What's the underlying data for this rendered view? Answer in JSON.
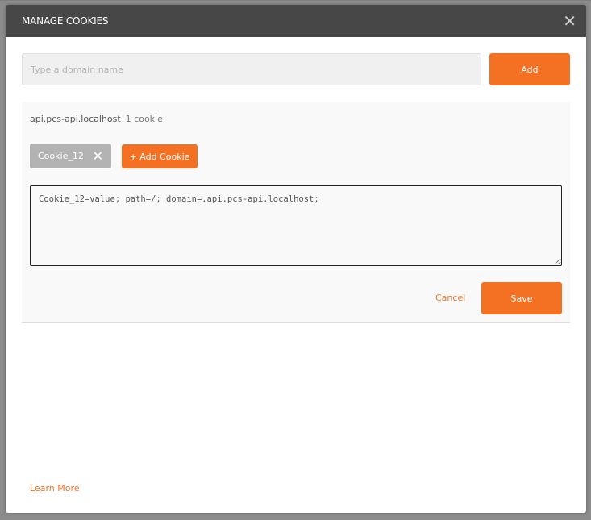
{
  "modal": {
    "title": "MANAGE COOKIES",
    "close_icon": "close-icon"
  },
  "domain_input": {
    "placeholder": "Type a domain name",
    "value": ""
  },
  "add_label": "Add",
  "domain": {
    "name": "api.pcs-api.localhost",
    "count": "1 cookie"
  },
  "cookies": [
    {
      "name": "Cookie_12"
    }
  ],
  "add_cookie_label": "+ Add Cookie",
  "editor_value": "Cookie_12=value; path=/; domain=.api.pcs-api.localhost;",
  "cancel_label": "Cancel",
  "save_label": "Save",
  "learn_more": "Learn More",
  "colors": {
    "accent": "#f47023",
    "header": "#474747"
  }
}
